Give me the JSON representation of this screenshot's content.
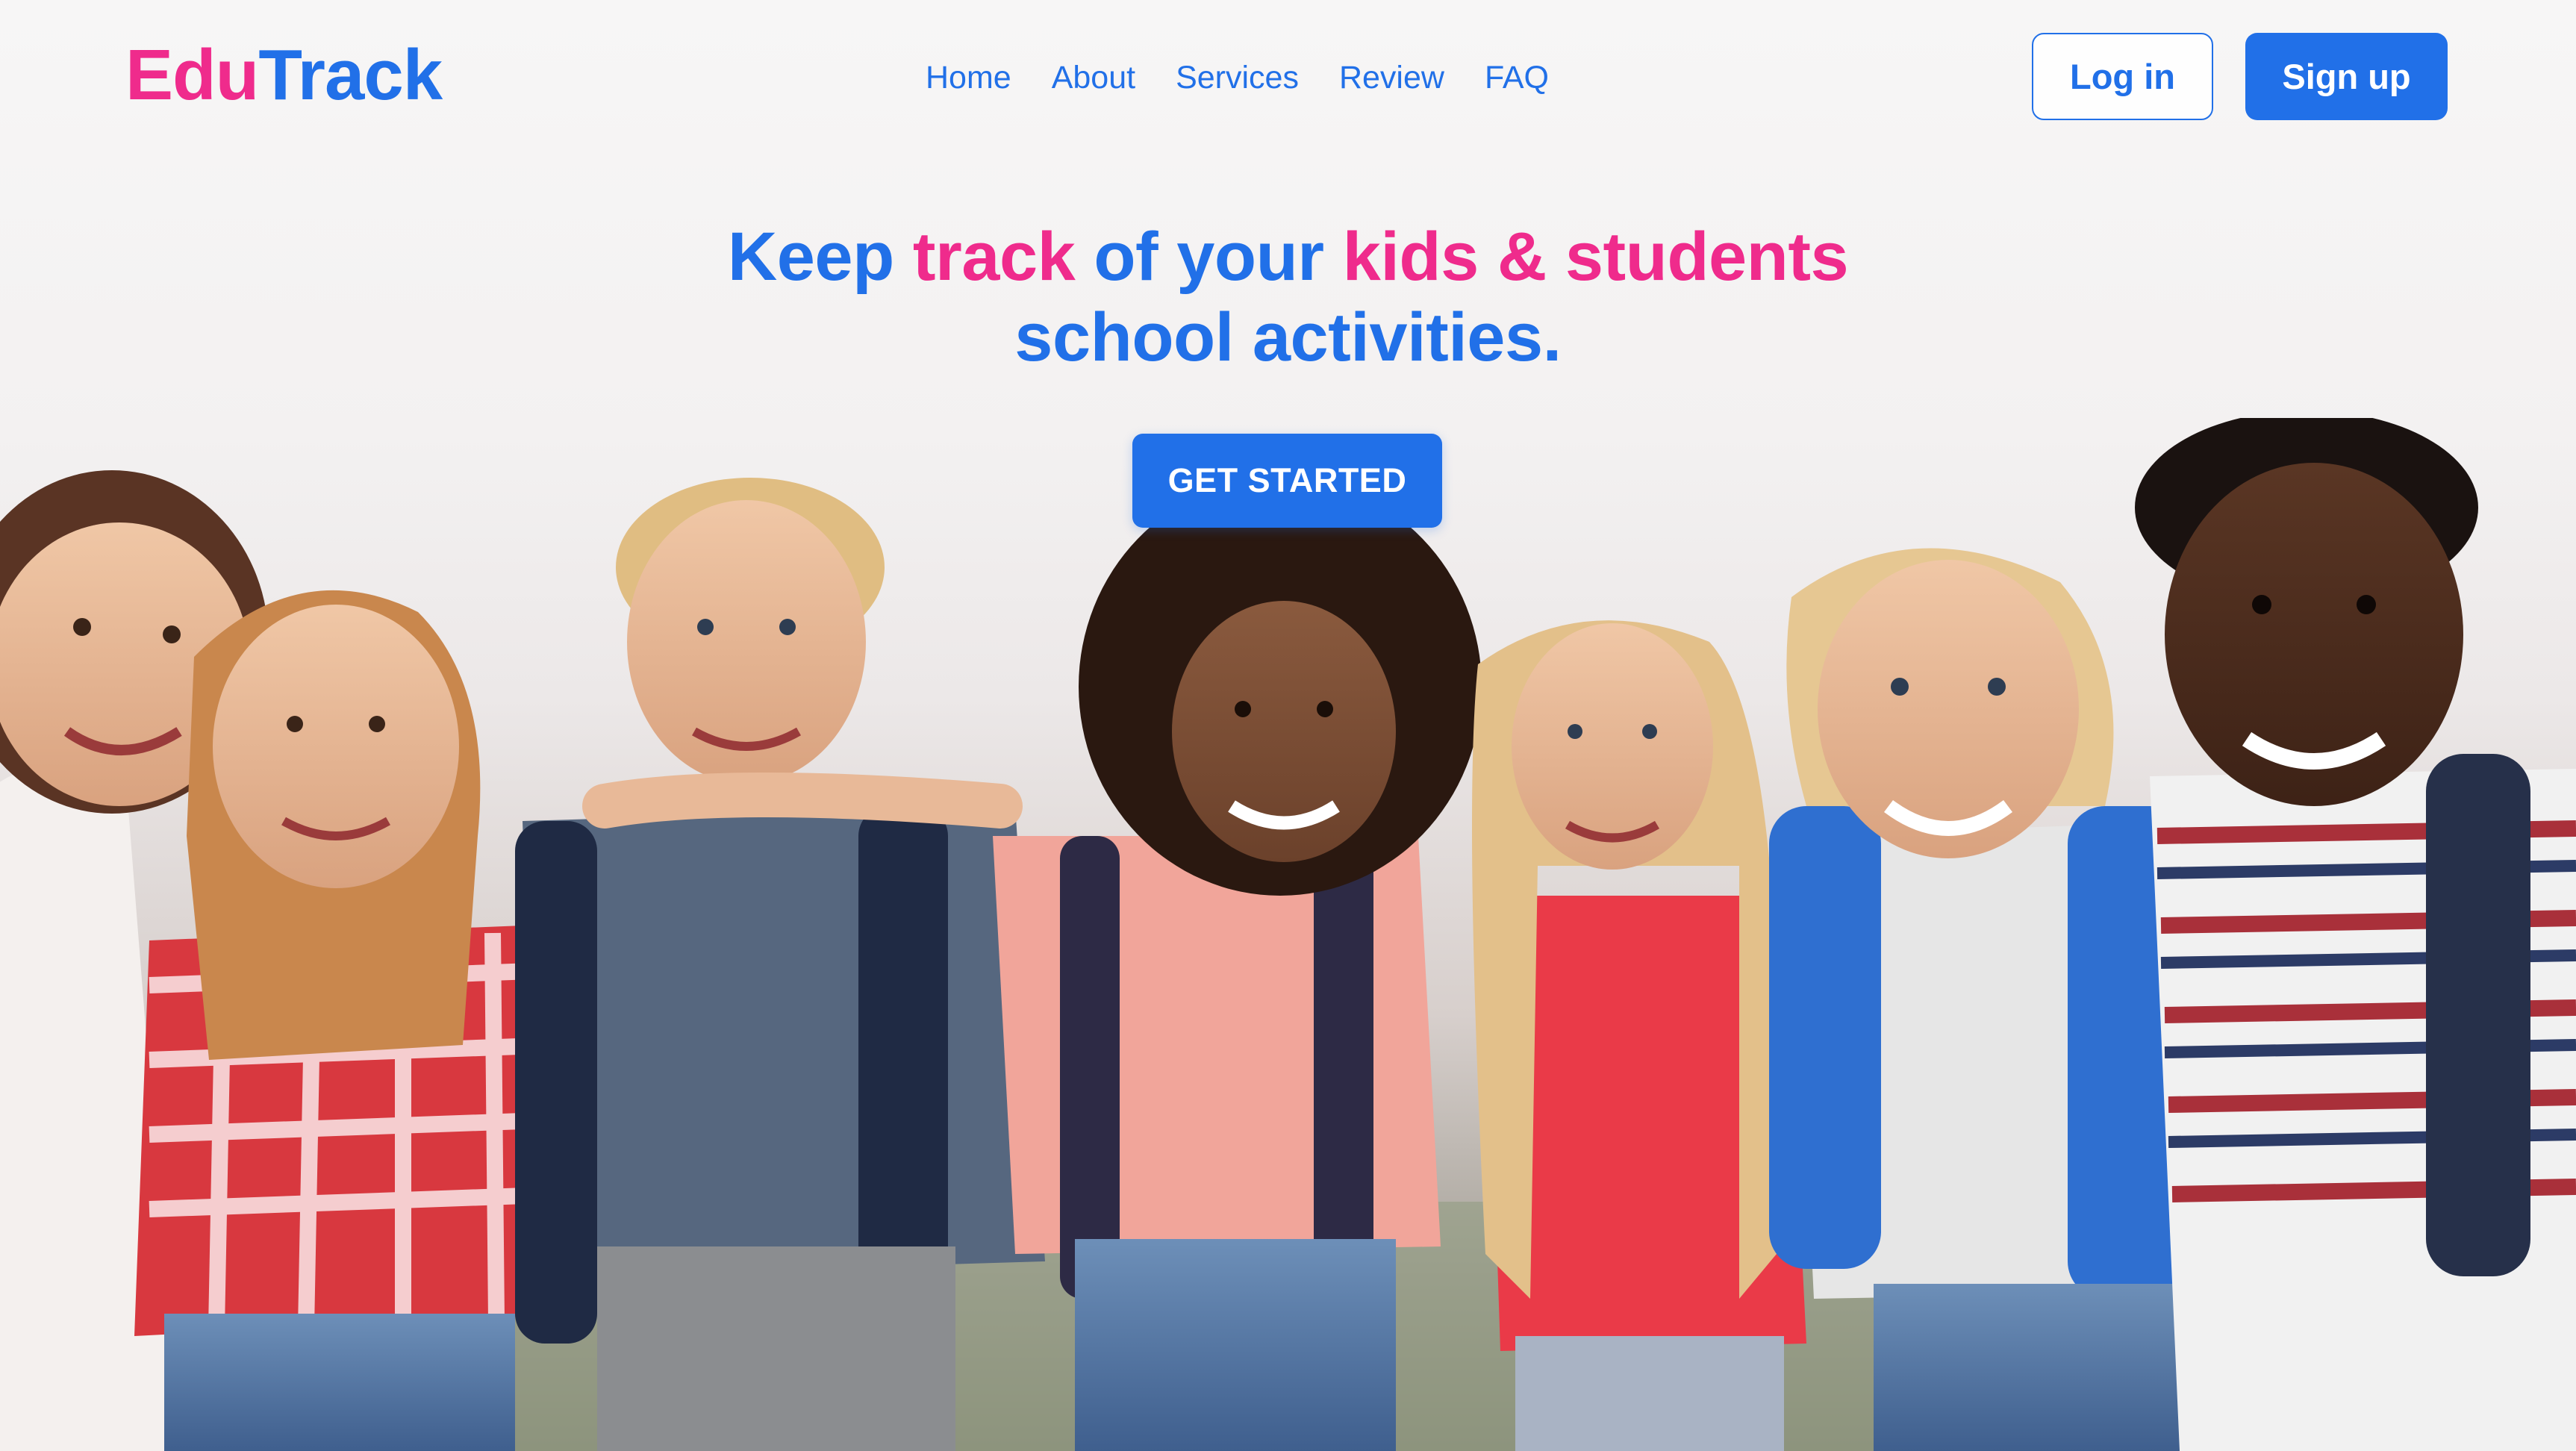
{
  "brand": {
    "logo_part1": "Edu",
    "logo_part2": "Track",
    "color_pink": "#ef2b8c",
    "color_blue": "#2170e8"
  },
  "nav": {
    "items": [
      "Home",
      "About",
      "Services",
      "Review",
      "FAQ"
    ]
  },
  "auth": {
    "login_label": "Log in",
    "signup_label": "Sign up"
  },
  "hero": {
    "headline": {
      "w1": "Keep ",
      "w2": "track",
      "w3": " of your ",
      "w4": "kids & students",
      "w5": "school activities."
    },
    "cta_label": "GET STARTED",
    "image_icon": "children-group-photo"
  }
}
